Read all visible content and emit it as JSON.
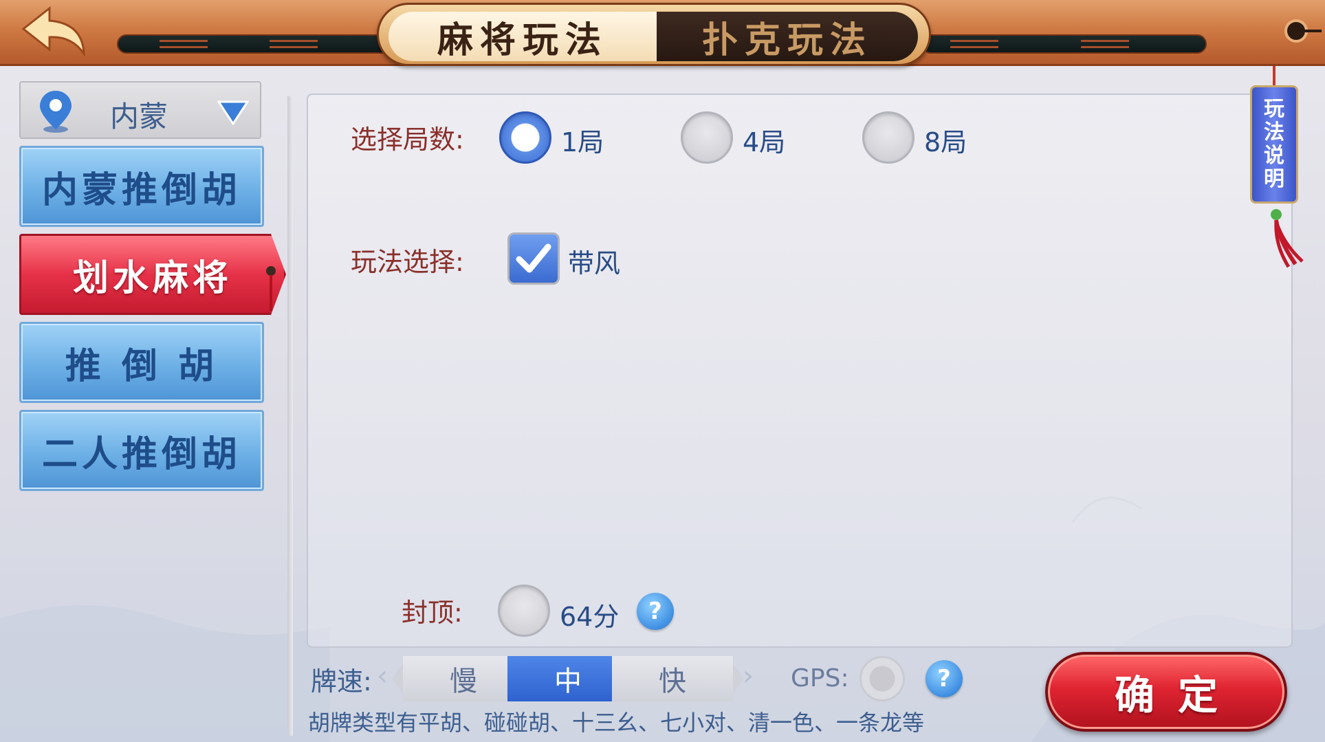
{
  "header": {
    "tabs": [
      {
        "label": "麻将玩法",
        "active": true
      },
      {
        "label": "扑克玩法",
        "active": false
      }
    ]
  },
  "sidebar": {
    "region": "内蒙",
    "games": [
      {
        "label": "内蒙推倒胡",
        "selected": false
      },
      {
        "label": "划水麻将",
        "selected": true
      },
      {
        "label": "推 倒 胡",
        "selected": false
      },
      {
        "label": "二人推倒胡",
        "selected": false
      }
    ]
  },
  "settings": {
    "rounds": {
      "label": "选择局数:",
      "options": [
        "1局",
        "4局",
        "8局"
      ],
      "selected": "1局"
    },
    "mode": {
      "label": "玩法选择:",
      "options": [
        {
          "label": "带风",
          "checked": true
        }
      ]
    },
    "cap": {
      "label": "封顶:",
      "option": "64分",
      "help": "?"
    }
  },
  "footer": {
    "speed_label": "牌速:",
    "speed_options": [
      "慢",
      "中",
      "快"
    ],
    "speed_selected": "中",
    "gps_label": "GPS:",
    "gps_help": "?",
    "note": "胡牌类型有平胡、碰碰胡、十三幺、七小对、清一色、一条龙等",
    "confirm_label": "确定"
  },
  "rules_tab": {
    "label": "玩法说明",
    "chars": [
      "玩",
      "法",
      "说",
      "明"
    ]
  },
  "colors": {
    "accent_blue": "#3a6bd4",
    "selected_red": "#e63248",
    "label_red": "#8a2f2a",
    "topbar_orange": "#cf7a44"
  }
}
